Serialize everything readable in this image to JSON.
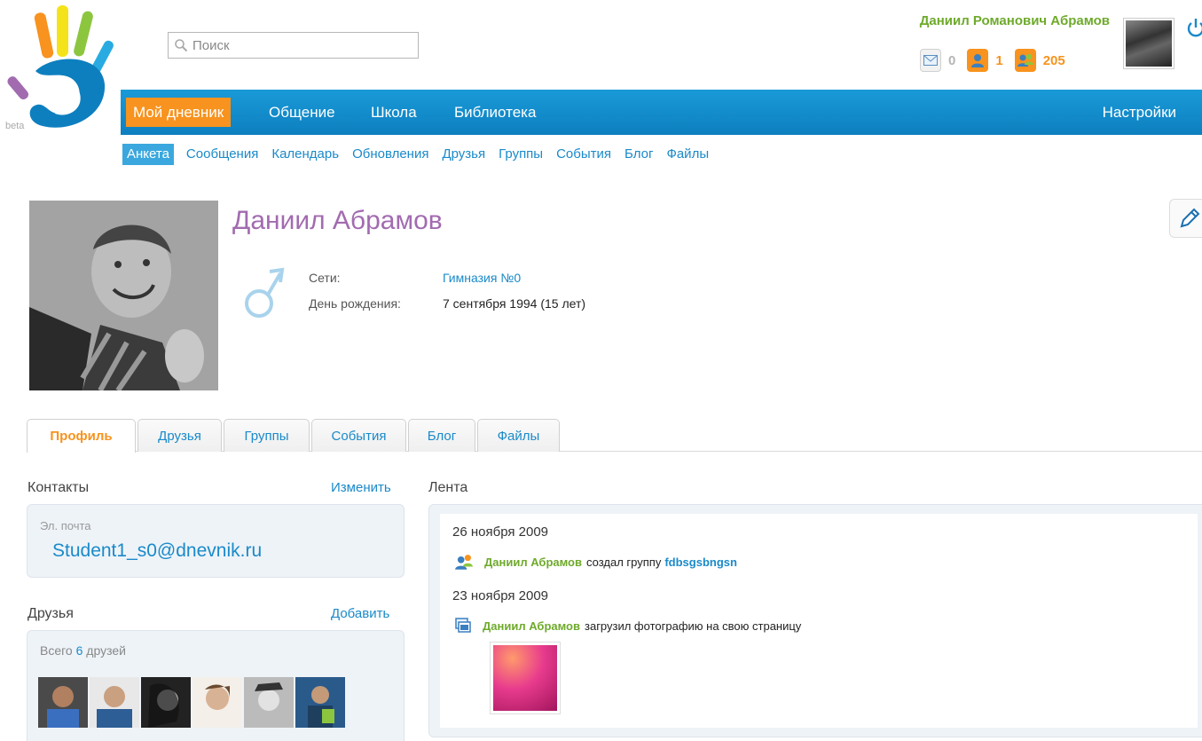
{
  "logo": {
    "beta_label": "beta",
    "colors": [
      "#f7931e",
      "#f4e31b",
      "#8cc63f",
      "#29abe2",
      "#a26bb0",
      "#0d7fbf"
    ]
  },
  "search": {
    "placeholder": "Поиск",
    "icon": "search-icon"
  },
  "header_user": {
    "name": "Даниил Романович Абрамов",
    "messages_count": "0",
    "friend_requests_count": "1",
    "groups_count": "205",
    "icons": [
      "mail-icon",
      "user-icon",
      "group-icon",
      "power-icon"
    ]
  },
  "main_nav": {
    "items": [
      "Мой дневник",
      "Общение",
      "Школа",
      "Библиотека"
    ],
    "settings": "Настройки",
    "active_index": 0
  },
  "sub_nav": {
    "items": [
      "Анкета",
      "Сообщения",
      "Календарь",
      "Обновления",
      "Друзья",
      "Группы",
      "События",
      "Блог",
      "Файлы"
    ],
    "active_index": 0
  },
  "profile": {
    "name": "Даниил Абрамов",
    "networks_label": "Сети:",
    "networks_value": "Гимназия №0",
    "birthday_label": "День рождения:",
    "birthday_value": "7 сентября 1994 (15 лет)",
    "gender_icon": "male-icon",
    "edit_icon": "pencil-icon"
  },
  "tabs": {
    "items": [
      "Профиль",
      "Друзья",
      "Группы",
      "События",
      "Блог",
      "Файлы"
    ],
    "active_index": 0
  },
  "contacts": {
    "title": "Контакты",
    "edit_link": "Изменить",
    "email_label": "Эл. почта",
    "email_value": "Student1_s0@dnevnik.ru"
  },
  "friends": {
    "title": "Друзья",
    "add_link": "Добавить",
    "count_prefix": "Всего",
    "count": "6",
    "count_suffix": "друзей"
  },
  "feed": {
    "title": "Лента",
    "entries": [
      {
        "date": "26 ноября 2009",
        "user": "Даниил Абрамов",
        "action": "создал группу",
        "target": "fdbsgsbngsn",
        "icon": "group-icon"
      },
      {
        "date": "23 ноября 2009",
        "user": "Даниил Абрамов",
        "action": "загрузил фотографию на свою страницу",
        "icon": "photo-gallery-icon"
      }
    ]
  },
  "colors": {
    "brand_blue": "#1a8ac9",
    "nav_blue": "#0d7fbf",
    "accent_orange": "#f7931e",
    "name_purple": "#a26bb0",
    "user_green": "#6eaa2b"
  }
}
